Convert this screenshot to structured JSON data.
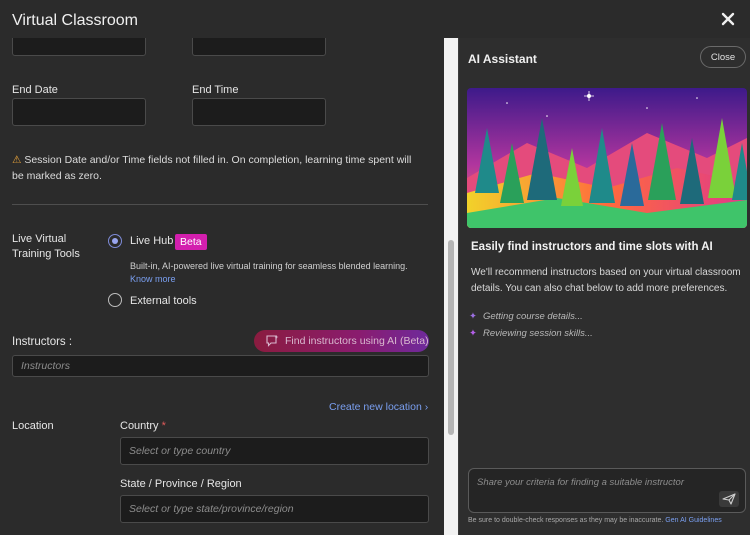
{
  "window": {
    "title": "Virtual Classroom"
  },
  "form": {
    "end_date_label": "End Date",
    "end_time_label": "End Time",
    "warning_icon": "warning-triangle-icon",
    "warning": "Session Date and/or Time fields not filled in. On completion, learning time spent will be marked as zero.",
    "live_tools_label": "Live Virtual Training Tools",
    "live_hub_label": "Live Hub",
    "beta_badge": "Beta",
    "live_hub_desc": "Built-in, AI-powered live virtual training for seamless blended learning.",
    "know_more": "Know more",
    "external_tools_label": "External tools",
    "instructors_label": "Instructors :",
    "find_ai_button": "Find instructors using AI (Beta)",
    "instructors_placeholder": "Instructors",
    "create_location": "Create new location",
    "location_label": "Location",
    "country_label": "Country",
    "required_mark": "*",
    "country_placeholder": "Select or type country",
    "state_label": "State / Province / Region",
    "state_placeholder": "Select or type state/province/region"
  },
  "assistant": {
    "title": "AI Assistant",
    "close": "Close",
    "heading": "Easily find instructors and time slots with AI",
    "body": "We'll recommend instructors based on your virtual classroom details. You can also chat below to add more preferences.",
    "steps": [
      "Getting course details...",
      "Reviewing session skills..."
    ],
    "chat_placeholder": "Share your criteria for finding a suitable instructor",
    "disclaimer": "Be sure to double-check responses as they may be inaccurate.",
    "guidelines_link": "Gen AI Guidelines"
  },
  "colors": {
    "accent": "#7a9ff0",
    "beta": "#d31fae",
    "warning": "#e8a33a"
  }
}
